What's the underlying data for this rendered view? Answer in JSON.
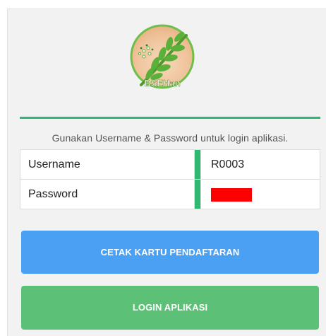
{
  "logo": {
    "text": "BSEHan"
  },
  "hint": "Gunakan Username & Password untuk login aplikasi.",
  "form": {
    "username_label": "Username",
    "username_value": "R0003",
    "password_label": "Password"
  },
  "buttons": {
    "print_card": "CETAK KARTU PENDAFTARAN",
    "login": "LOGIN APLIKASI"
  },
  "colors": {
    "accent_green": "#2eb872",
    "button_blue": "#4aa0f3",
    "button_green": "#5cc176",
    "password_mask": "#ff0000"
  }
}
